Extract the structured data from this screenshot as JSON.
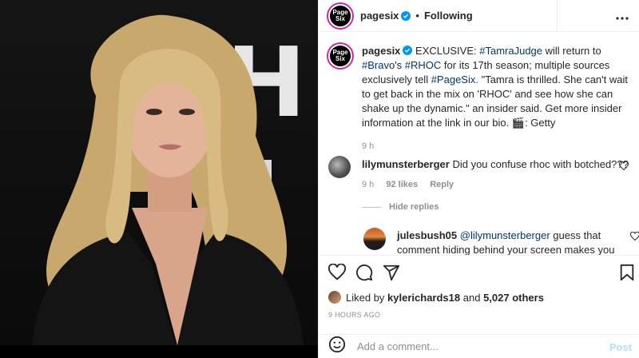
{
  "header": {
    "username": "pagesix",
    "logo_text": "Page Six",
    "dot": "•",
    "follow_label": "Following",
    "more_label": "..."
  },
  "caption": {
    "username": "pagesix",
    "parts": {
      "p1": " EXCLUSIVE: ",
      "h1": "#TamraJudge",
      "p2": " will return to ",
      "h2": "#Bravo",
      "p3": "'s ",
      "h3": "#RHOC",
      "p4": " for its 17th season; multiple sources exclusively tell ",
      "h4": "#PageSix",
      "p5": ". \"Tamra is thrilled. She can't wait to get back in the mix on 'RHOC' and see how she can shake up the dynamic.\" an insider said. Get more insider information at the link in our bio. 🎬: Getty"
    },
    "time": "9 h"
  },
  "comments": [
    {
      "username": "lilymunsterberger",
      "text": "Did you confuse rhoc with botched???",
      "time": "9 h",
      "likes": "92 likes",
      "reply": "Reply"
    }
  ],
  "hide_replies": "Hide replies",
  "reply": {
    "username": "julesbush05",
    "mention": "@lilymunsterberger",
    "text": " guess that comment hiding behind your screen makes you feel pretty good"
  },
  "likes": {
    "prefix": "Liked by ",
    "user": "kylerichards18",
    "mid": " and ",
    "count": "5,027 others"
  },
  "posted_ago": "9 HOURS AGO",
  "add_comment": {
    "placeholder": "Add a comment...",
    "post_label": "Post"
  },
  "colors": {
    "link": "#00376b",
    "muted": "#8e8e8e",
    "post_disabled": "#b2dffc",
    "verified": "#0095f6"
  },
  "icons": [
    "heart-icon",
    "comment-icon",
    "share-icon",
    "bookmark-icon",
    "emoji-icon",
    "verified-badge-icon",
    "more-icon"
  ]
}
